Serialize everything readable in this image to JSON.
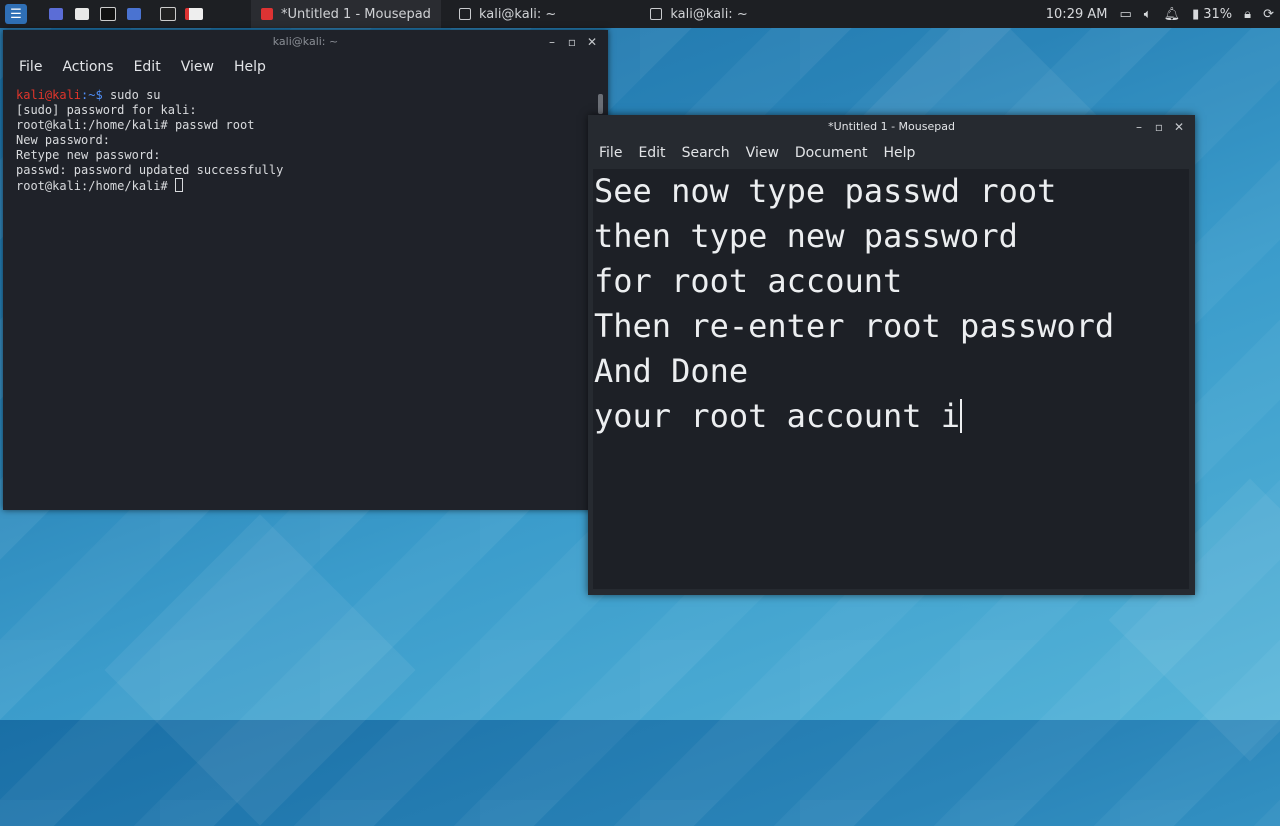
{
  "panel": {
    "tasks": [
      {
        "label": "*Untitled 1 - Mousepad",
        "active": true
      },
      {
        "label": "kali@kali: ~",
        "active": false
      },
      {
        "label": "kali@kali: ~",
        "active": false
      }
    ],
    "clock": "10:29 AM",
    "battery": "31%"
  },
  "terminal": {
    "title": "kali@kali: ~",
    "menu": [
      "File",
      "Actions",
      "Edit",
      "View",
      "Help"
    ],
    "prompt_user": "kali@kali",
    "prompt_path": ":~$",
    "lines": [
      " sudo su",
      "[sudo] password for kali:",
      "root@kali:/home/kali# passwd root",
      "New password:",
      "Retype new password:",
      "passwd: password updated successfully",
      "root@kali:/home/kali# "
    ]
  },
  "mousepad": {
    "title": "*Untitled 1 - Mousepad",
    "menu": [
      "File",
      "Edit",
      "Search",
      "View",
      "Document",
      "Help"
    ],
    "lines": [
      "See now type passwd root",
      "then type new password",
      "for root account",
      "Then re-enter root password",
      "And Done",
      "your root account i"
    ]
  },
  "colors": {
    "panel": "#1d1f23",
    "terminal_bg": "#1f2229",
    "editor_bg": "#1d2026",
    "prompt_red": "#e0352b"
  }
}
